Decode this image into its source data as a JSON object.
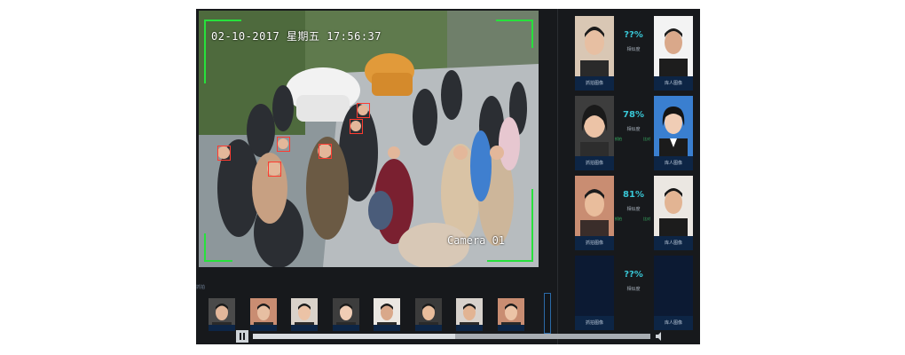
{
  "video": {
    "timestamp": "02-10-2017 星期五 17:56:37",
    "camera_label": "Camera 01"
  },
  "matches": [
    {
      "score": "??%",
      "score_label": "相似度",
      "left_caption": "抓拍图像",
      "right_caption": "库人图像",
      "left_tag": "",
      "right_tag": ""
    },
    {
      "score": "78%",
      "score_label": "相似度",
      "left_caption": "抓拍图像",
      "right_caption": "库人图像",
      "left_tag": "抓拍",
      "right_tag": "比对"
    },
    {
      "score": "81%",
      "score_label": "相似度",
      "left_caption": "抓拍图像",
      "right_caption": "库人图像",
      "left_tag": "抓拍",
      "right_tag": "比对"
    },
    {
      "score": "??%",
      "score_label": "相似度",
      "left_caption": "抓拍图像",
      "right_caption": "库人图像",
      "left_tag": "",
      "right_tag": ""
    }
  ],
  "filmstrip": {
    "label": "抓拍",
    "items": [
      {
        "caption": ""
      },
      {
        "caption": ""
      },
      {
        "caption": ""
      },
      {
        "caption": ""
      },
      {
        "caption": ""
      },
      {
        "caption": ""
      },
      {
        "caption": ""
      },
      {
        "caption": ""
      }
    ]
  },
  "playback": {
    "progress": 0.51
  },
  "colors": {
    "accent": "#39c7d6",
    "detect_box": "#27e13c",
    "face_box": "#ff3b30",
    "panel": "#0d2545"
  },
  "icons": {
    "pause": "pause-icon",
    "volume": "volume-icon"
  }
}
